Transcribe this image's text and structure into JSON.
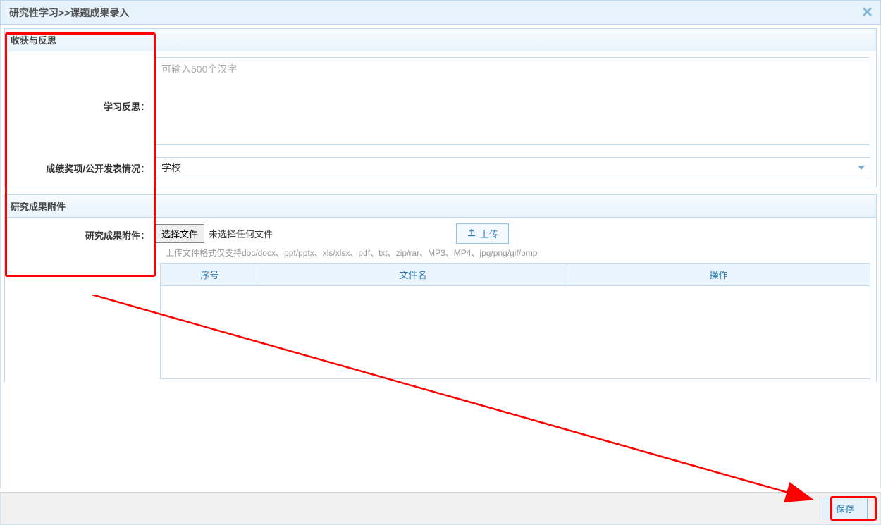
{
  "title_bar": {
    "breadcrumb": "研究性学习>>课题成果录入"
  },
  "section1": {
    "header": "收获与反思",
    "reflection_label": "学习反思：",
    "reflection_placeholder": "可输入500个汉字",
    "award_label": "成绩奖项/公开发表情况：",
    "award_value": "学校"
  },
  "section2": {
    "header": "研究成果附件",
    "attachment_label": "研究成果附件：",
    "choose_file": "选择文件",
    "no_file": "未选择任何文件",
    "upload": "上传",
    "hint": "上传文件格式仅支持doc/docx、ppt/pptx、xls/xlsx、pdf、txt、zip/rar、MP3、MP4、jpg/png/gif/bmp",
    "columns": {
      "index": "序号",
      "filename": "文件名",
      "action": "操作"
    }
  },
  "footer": {
    "save": "保存"
  }
}
